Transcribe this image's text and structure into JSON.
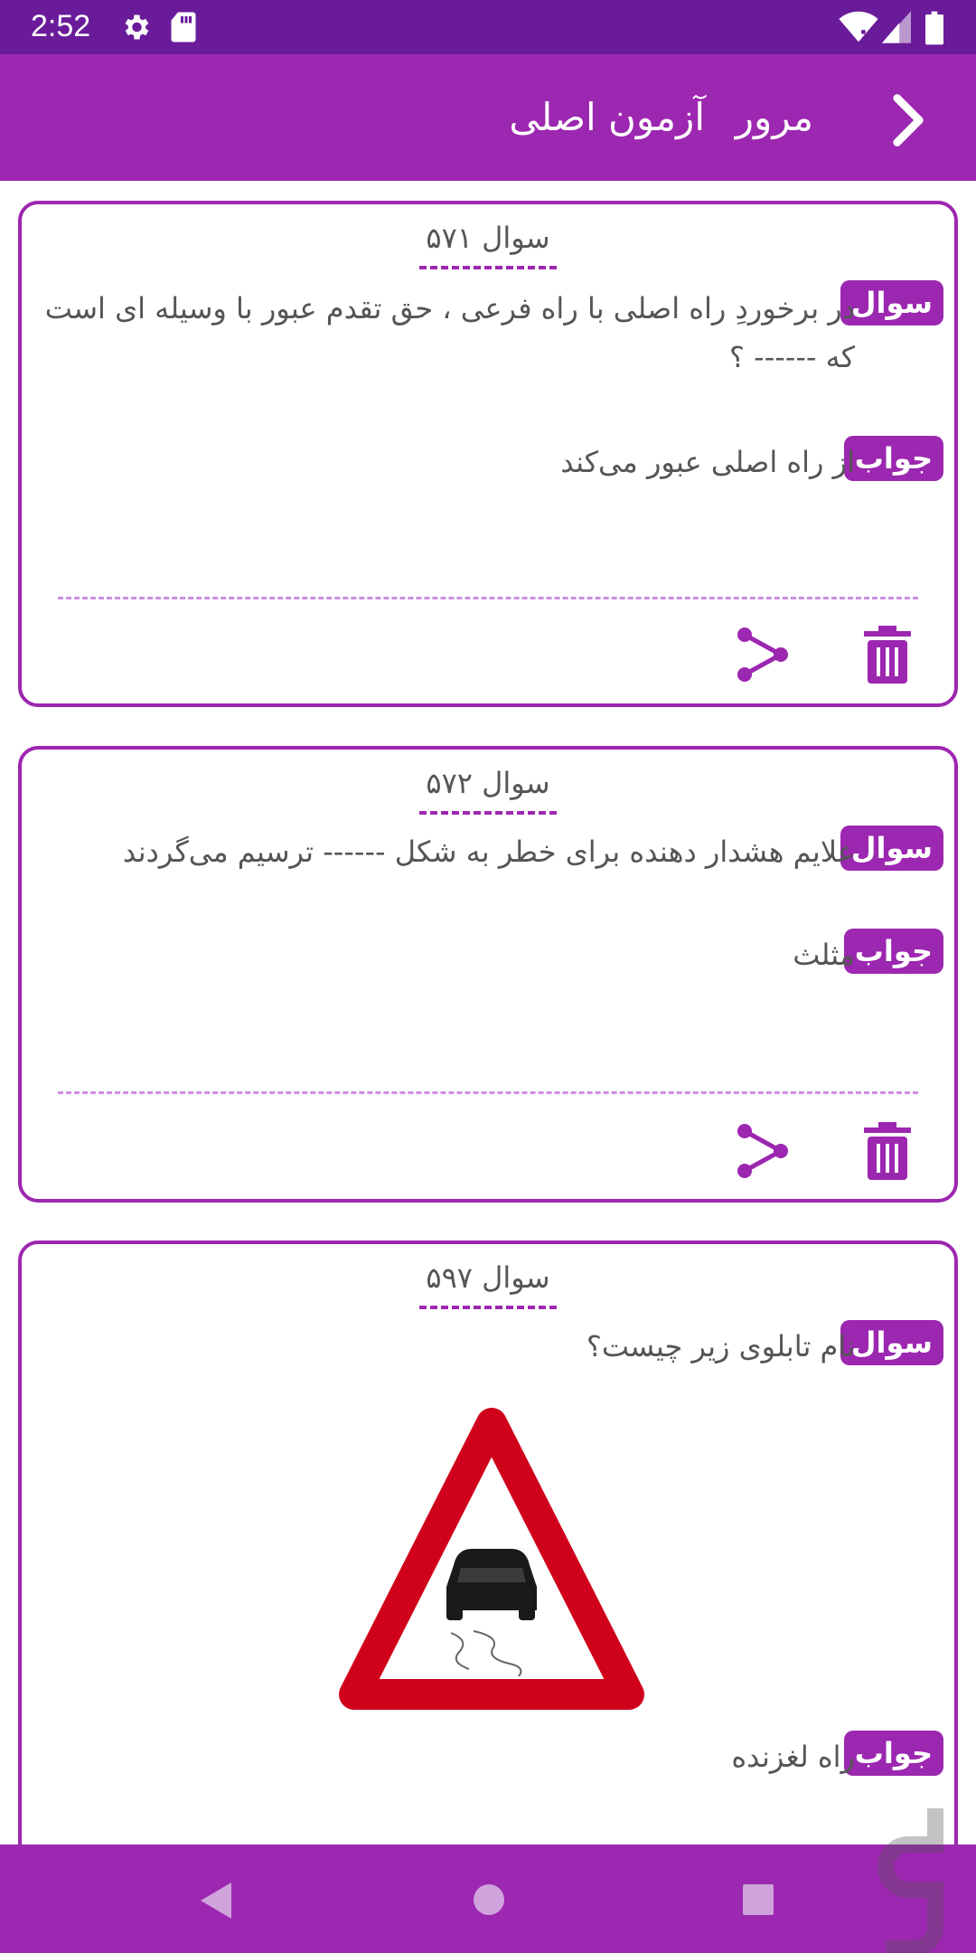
{
  "status_bar": {
    "time": "2:52"
  },
  "app_bar": {
    "title": "آزمون اصلی",
    "section": "مرور"
  },
  "labels": {
    "question": "سوال",
    "answer": "جواب"
  },
  "cards": [
    {
      "title": "سوال ۵۷۱",
      "question": "در برخوردِ راه اصلی با راه فرعی ، حق تقدم عبور با وسیله ای است که ------ ؟",
      "answer": "از راه اصلی عبور می‌کند"
    },
    {
      "title": "سوال ۵۷۲",
      "question": "علایم هشدار دهنده برای خطر به شکل ------ ترسیم می‌گردند",
      "answer": "مثلث"
    },
    {
      "title": "سوال ۵۹۷",
      "question": "نام تابلوی زیر چیست؟",
      "answer": "راه لغزنده",
      "image": "slippery-road-sign"
    }
  ],
  "colors": {
    "primary": "#9c27b0",
    "primary_dark": "#6a1b9a",
    "sign_red": "#d0021b"
  },
  "icons": [
    "back-chevron-icon",
    "share-icon",
    "trash-icon",
    "gear-icon",
    "sd-card-icon",
    "wifi-icon",
    "signal-icon",
    "battery-icon"
  ]
}
